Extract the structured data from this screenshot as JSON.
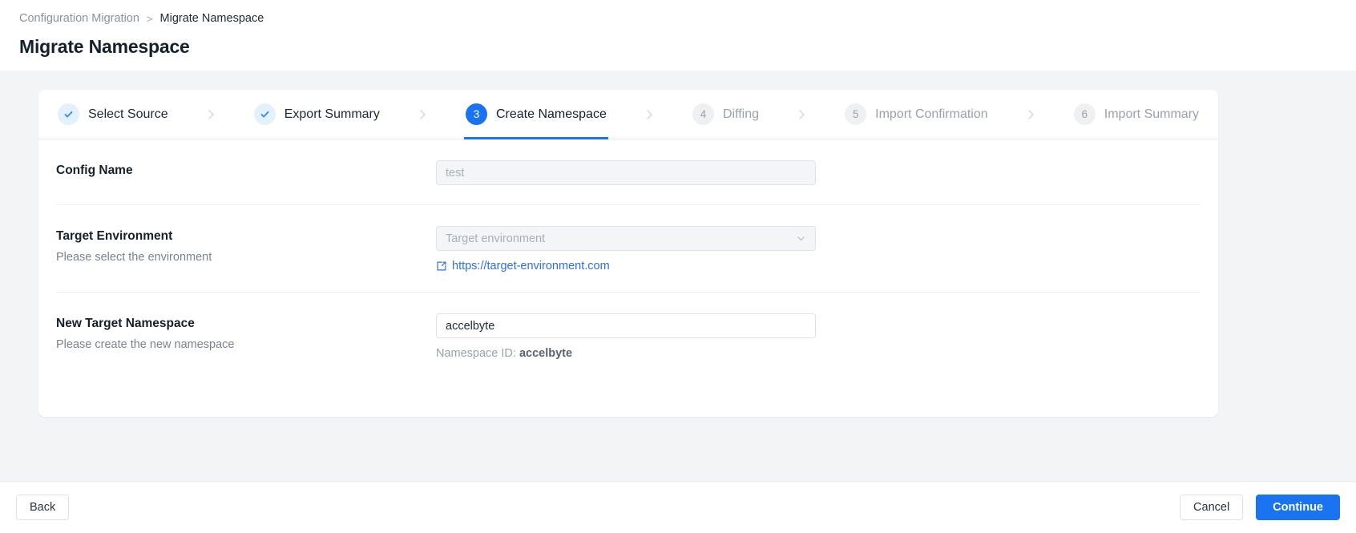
{
  "breadcrumb": {
    "parent": "Configuration Migration",
    "separator": ">",
    "current": "Migrate Namespace"
  },
  "page_title": "Migrate Namespace",
  "colors": {
    "primary": "#1a73f0",
    "link": "#2f6fe4",
    "done_badge_bg": "#e3f1fd",
    "done_badge_fg": "#2f86e8",
    "todo_badge_bg": "#eef0f2",
    "page_bg": "#f2f4f6"
  },
  "stepper": {
    "steps": [
      {
        "number": "1",
        "label": "Select Source",
        "state": "done"
      },
      {
        "number": "2",
        "label": "Export Summary",
        "state": "done"
      },
      {
        "number": "3",
        "label": "Create Namespace",
        "state": "active"
      },
      {
        "number": "4",
        "label": "Diffing",
        "state": "todo"
      },
      {
        "number": "5",
        "label": "Import Confirmation",
        "state": "todo"
      },
      {
        "number": "6",
        "label": "Import Summary",
        "state": "todo"
      }
    ]
  },
  "form": {
    "config_name": {
      "title": "Config Name",
      "value": "test",
      "placeholder": "test"
    },
    "target_environment": {
      "title": "Target Environment",
      "subtitle": "Please select the environment",
      "placeholder": "Target environment",
      "value": "",
      "link_text": "https://target-environment.com"
    },
    "new_target_namespace": {
      "title": "New Target Namespace",
      "subtitle": "Please create the new namespace",
      "value": "accelbyte",
      "hint_label": "Namespace ID:",
      "hint_value": "accelbyte"
    }
  },
  "footer": {
    "back": "Back",
    "cancel": "Cancel",
    "continue": "Continue"
  }
}
